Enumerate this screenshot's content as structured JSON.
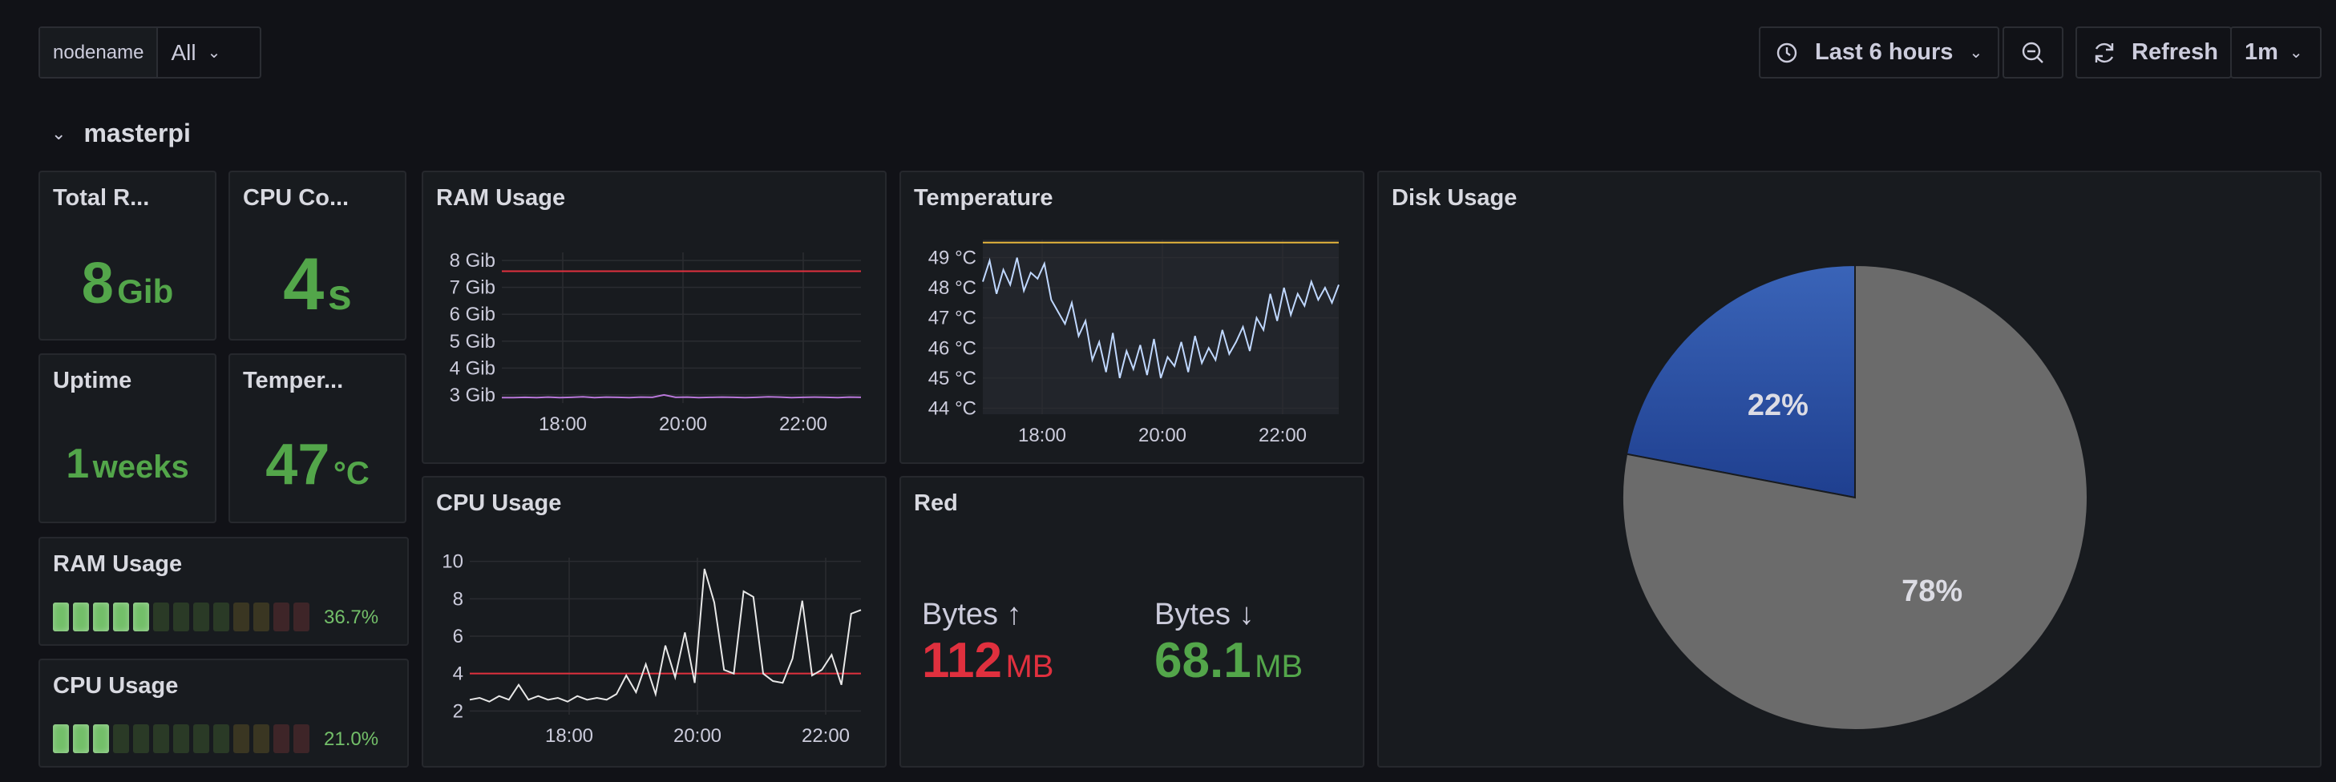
{
  "header": {
    "variable_label": "nodename",
    "variable_value": "All",
    "time_range": "Last 6 hours",
    "refresh_label": "Refresh",
    "refresh_interval": "1m"
  },
  "row": {
    "title": "masterpi"
  },
  "stats": {
    "total_ram": {
      "title": "Total R...",
      "value": "8",
      "unit": "Gib"
    },
    "cpu_cores": {
      "title": "CPU Co...",
      "value": "4",
      "unit": "s"
    },
    "uptime": {
      "title": "Uptime",
      "value": "1",
      "unit": "weeks"
    },
    "temperature": {
      "title": "Temper...",
      "value": "47",
      "unit": "°C"
    }
  },
  "gauges": {
    "ram": {
      "title": "RAM Usage",
      "value_text": "36.7%",
      "percent": 36.7
    },
    "cpu": {
      "title": "CPU Usage",
      "value_text": "21.0%",
      "percent": 21.0
    }
  },
  "network": {
    "title": "Red",
    "up_label": "Bytes ↑",
    "up_value": "112",
    "up_unit": "MB",
    "down_label": "Bytes ↓",
    "down_value": "68.1",
    "down_unit": "MB"
  },
  "colors": {
    "background": "#111217",
    "panel": "#181b1f",
    "green": "#53a64a",
    "red": "#e0303e",
    "pie_blue": "#2f54a8",
    "pie_gray": "#6e6e6e"
  },
  "chart_data": [
    {
      "id": "ram_usage",
      "type": "line",
      "title": "RAM Usage",
      "x_ticks": [
        "18:00",
        "20:00",
        "22:00"
      ],
      "y_ticks": [
        "3 Gib",
        "4 Gib",
        "5 Gib",
        "6 Gib",
        "7 Gib",
        "8 Gib"
      ],
      "ylim": [
        2.7,
        8.3
      ],
      "threshold": 7.6,
      "series": [
        {
          "color": "#b877d9",
          "values": [
            2.9,
            2.9,
            2.91,
            2.9,
            2.92,
            2.9,
            2.91,
            2.93,
            2.9,
            2.92,
            2.91,
            2.9,
            2.92,
            2.91,
            3.0,
            2.91,
            2.92,
            2.9,
            2.91,
            2.92,
            2.91,
            2.9,
            2.91,
            2.93,
            2.92,
            2.9,
            2.91,
            2.92,
            2.91,
            2.9,
            2.92,
            2.91
          ]
        }
      ]
    },
    {
      "id": "temperature",
      "type": "line",
      "title": "Temperature",
      "x_ticks": [
        "18:00",
        "20:00",
        "22:00"
      ],
      "y_ticks": [
        "44 °C",
        "45 °C",
        "46 °C",
        "47 °C",
        "48 °C",
        "49 °C"
      ],
      "ylim": [
        43.8,
        49.6
      ],
      "threshold": 49.5,
      "series": [
        {
          "color": "#c0d8ff",
          "values": [
            48.2,
            48.9,
            47.8,
            48.6,
            48.1,
            49.0,
            47.9,
            48.5,
            48.3,
            48.8,
            47.6,
            47.2,
            46.8,
            47.5,
            46.4,
            46.9,
            45.6,
            46.2,
            45.2,
            46.5,
            45.0,
            45.9,
            45.3,
            46.1,
            45.1,
            46.3,
            45.0,
            45.7,
            45.4,
            46.2,
            45.2,
            46.4,
            45.5,
            46.0,
            45.6,
            46.6,
            45.8,
            46.2,
            46.7,
            45.9,
            47.0,
            46.6,
            47.8,
            46.9,
            48.0,
            47.1,
            47.8,
            47.4,
            48.2,
            47.6,
            48.0,
            47.5,
            48.1
          ]
        }
      ]
    },
    {
      "id": "cpu_usage",
      "type": "line",
      "title": "CPU Usage",
      "x_ticks": [
        "18:00",
        "20:00",
        "22:00"
      ],
      "y_ticks": [
        "2",
        "4",
        "6",
        "8",
        "10"
      ],
      "ylim": [
        1.8,
        10.2
      ],
      "threshold": 4.0,
      "series": [
        {
          "color": "#e8e8e8",
          "values": [
            2.6,
            2.7,
            2.5,
            2.8,
            2.6,
            3.4,
            2.6,
            2.8,
            2.6,
            2.7,
            2.5,
            2.8,
            2.6,
            2.7,
            2.6,
            2.9,
            3.9,
            3.0,
            4.5,
            2.9,
            5.5,
            3.8,
            6.2,
            3.5,
            9.6,
            7.8,
            4.2,
            4.0,
            8.4,
            8.1,
            4.0,
            3.6,
            3.5,
            4.8,
            7.9,
            3.9,
            4.2,
            5.0,
            3.4,
            7.2,
            7.4
          ]
        }
      ]
    },
    {
      "id": "disk_usage",
      "type": "pie",
      "title": "Disk Usage",
      "labels": [
        "22%",
        "78%"
      ],
      "values": [
        22,
        78
      ]
    }
  ]
}
